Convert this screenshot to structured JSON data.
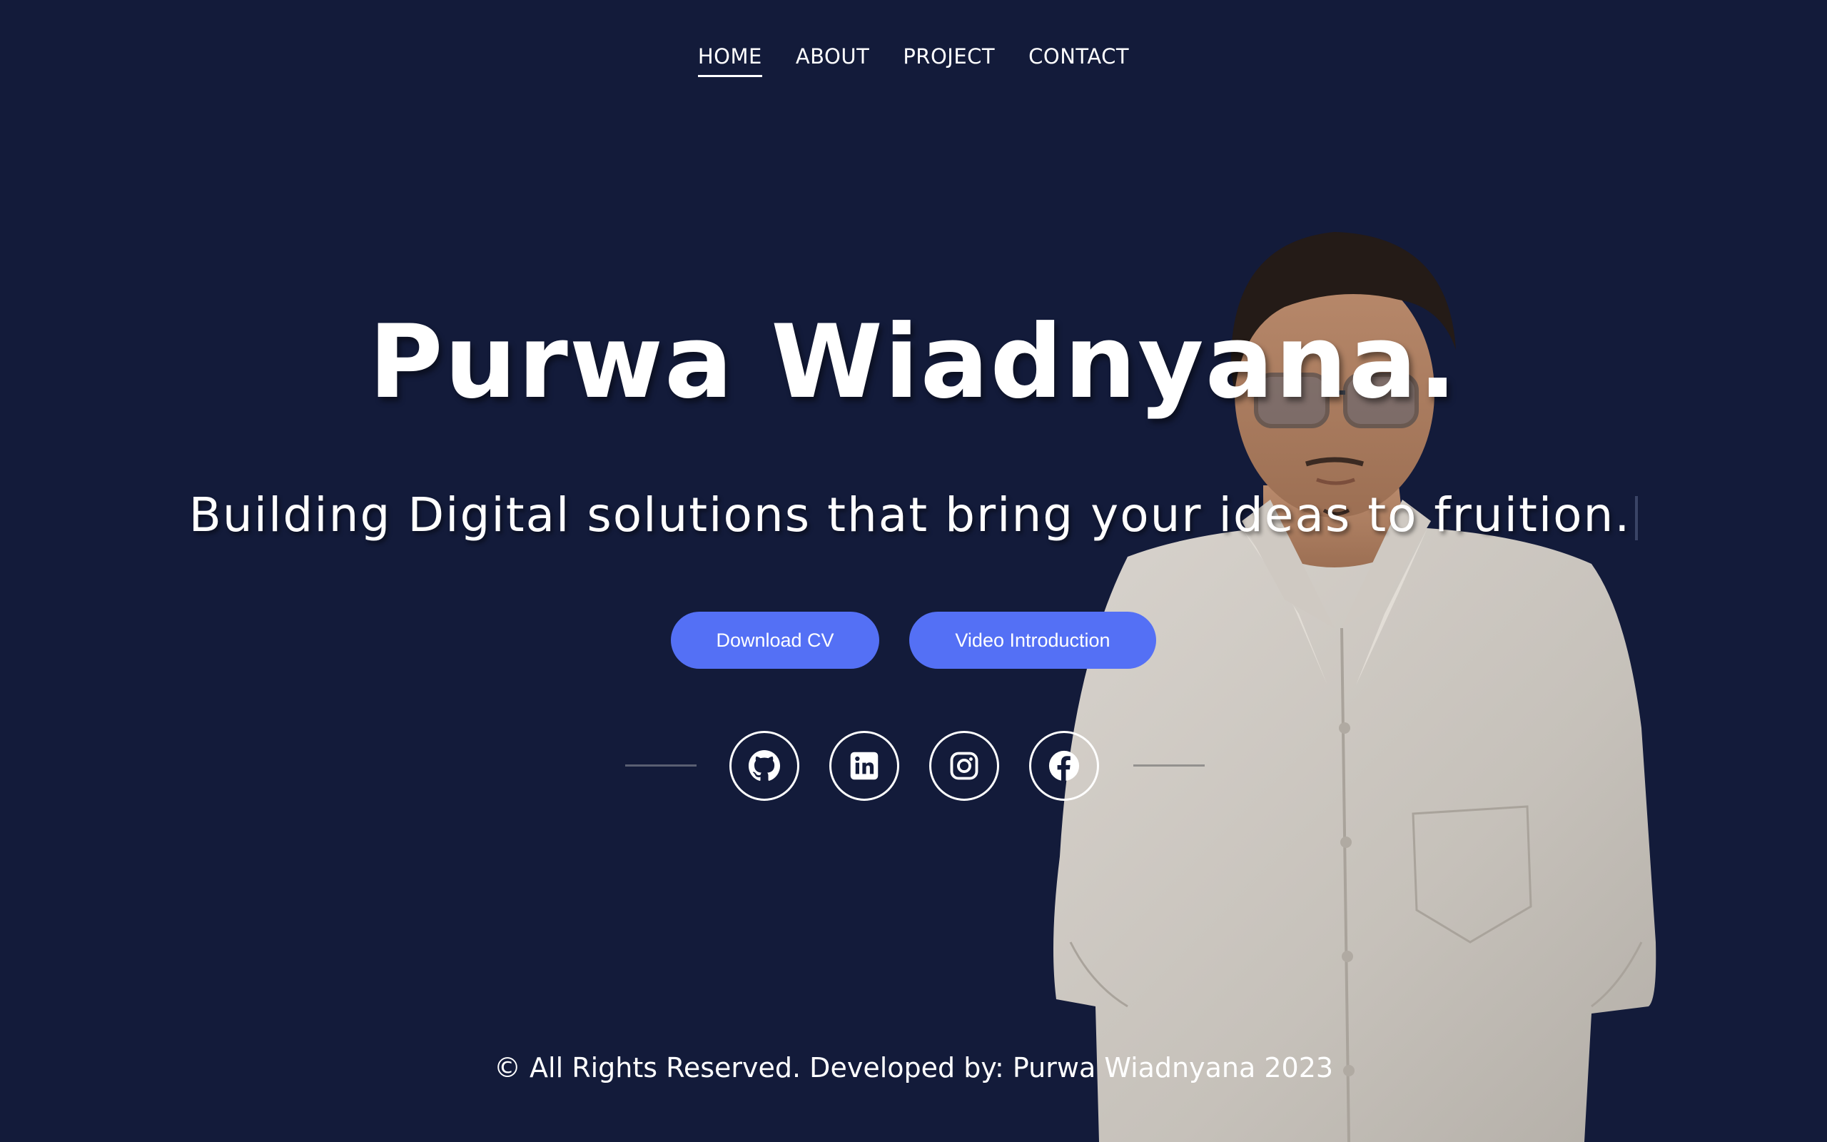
{
  "nav": {
    "items": [
      {
        "label": "HOME",
        "active": true
      },
      {
        "label": "ABOUT",
        "active": false
      },
      {
        "label": "PROJECT",
        "active": false
      },
      {
        "label": "CONTACT",
        "active": false
      }
    ]
  },
  "hero": {
    "name": "Purwa Wiadnyana.",
    "tagline": "Building Digital solutions that bring your ideas to fruition."
  },
  "buttons": {
    "download_cv": "Download CV",
    "video_intro": "Video Introduction"
  },
  "social": {
    "icons": [
      "github-icon",
      "linkedin-icon",
      "instagram-icon",
      "facebook-icon"
    ]
  },
  "footer": {
    "text": "© All Rights Reserved. Developed by: Purwa Wiadnyana  2023"
  },
  "colors": {
    "background": "#131b3a",
    "accent": "#5470f5",
    "text": "#ffffff"
  }
}
